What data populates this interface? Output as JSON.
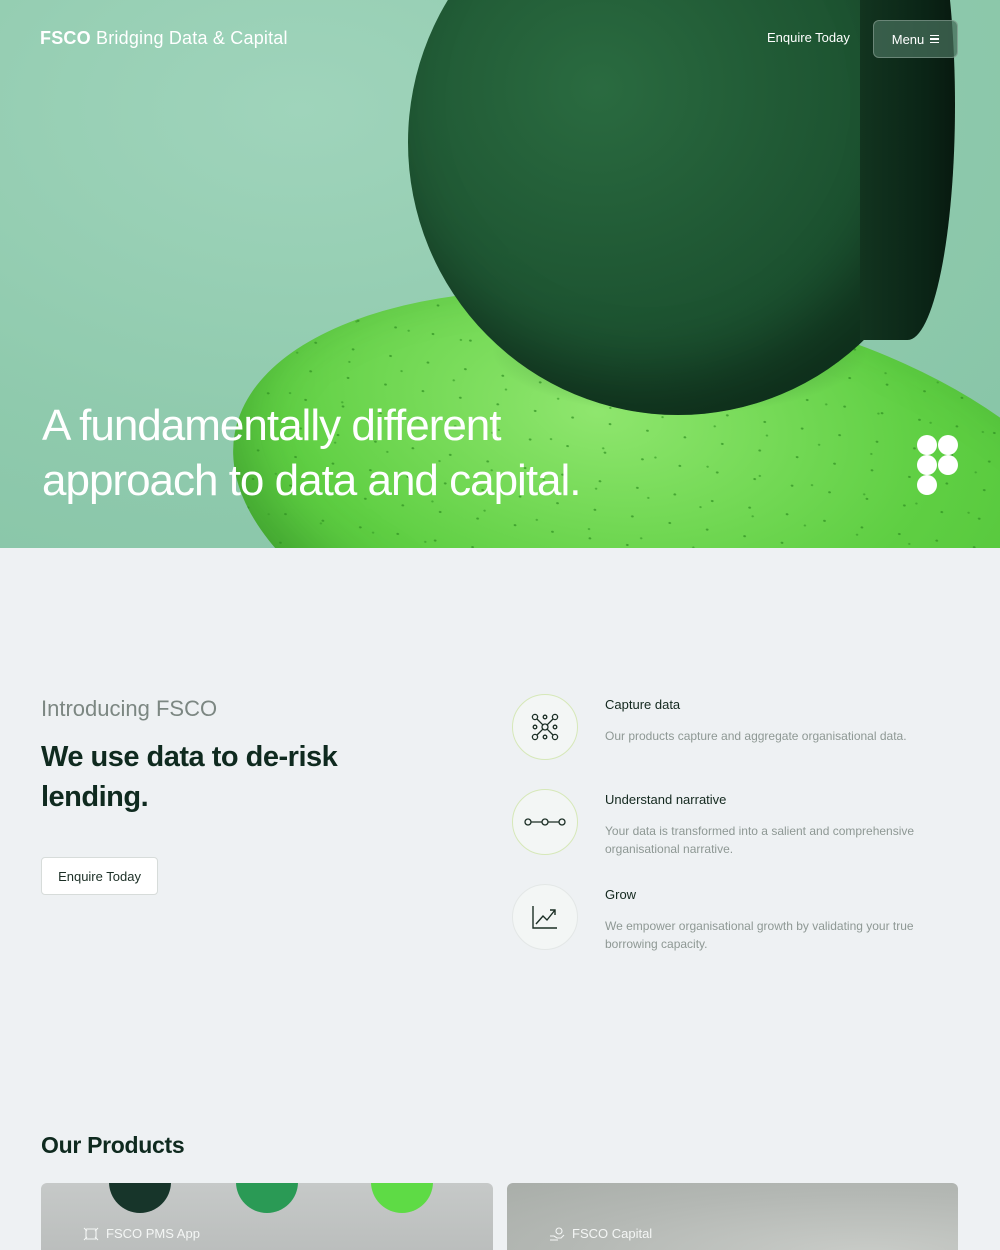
{
  "nav": {
    "brand_bold": "FSCO",
    "brand_tagline": "Bridging Data & Capital",
    "enquire_label": "Enquire Today",
    "menu_label": "Menu"
  },
  "hero": {
    "title_line1": "A fundamentally different",
    "title_line2": "approach to data and capital."
  },
  "intro": {
    "eyebrow": "Introducing FSCO",
    "title": "We use data to de-risk lending.",
    "button_label": "Enquire Today"
  },
  "features": [
    {
      "title": "Capture data",
      "description": "Our products capture and aggregate organisational data.",
      "icon": "network-icon"
    },
    {
      "title": "Understand narrative",
      "description": "Your data is transformed into a salient and comprehensive organisational narrative.",
      "icon": "nodes-line-icon"
    },
    {
      "title": "Grow",
      "description": "We empower organisational growth by validating your true borrowing capacity.",
      "icon": "trend-up-icon"
    }
  ],
  "products": {
    "title": "Our Products",
    "cards": [
      {
        "label": "FSCO PMS App",
        "icon": "app-icon"
      },
      {
        "label": "FSCO Capital",
        "icon": "hand-coin-icon"
      }
    ]
  },
  "colors": {
    "hero_bg": "#8fcaad",
    "disc_dark_green": "#1c5230",
    "slab_green": "#5fcf43",
    "ink": "#0f2a1f",
    "page_bg": "#eef1f3"
  }
}
